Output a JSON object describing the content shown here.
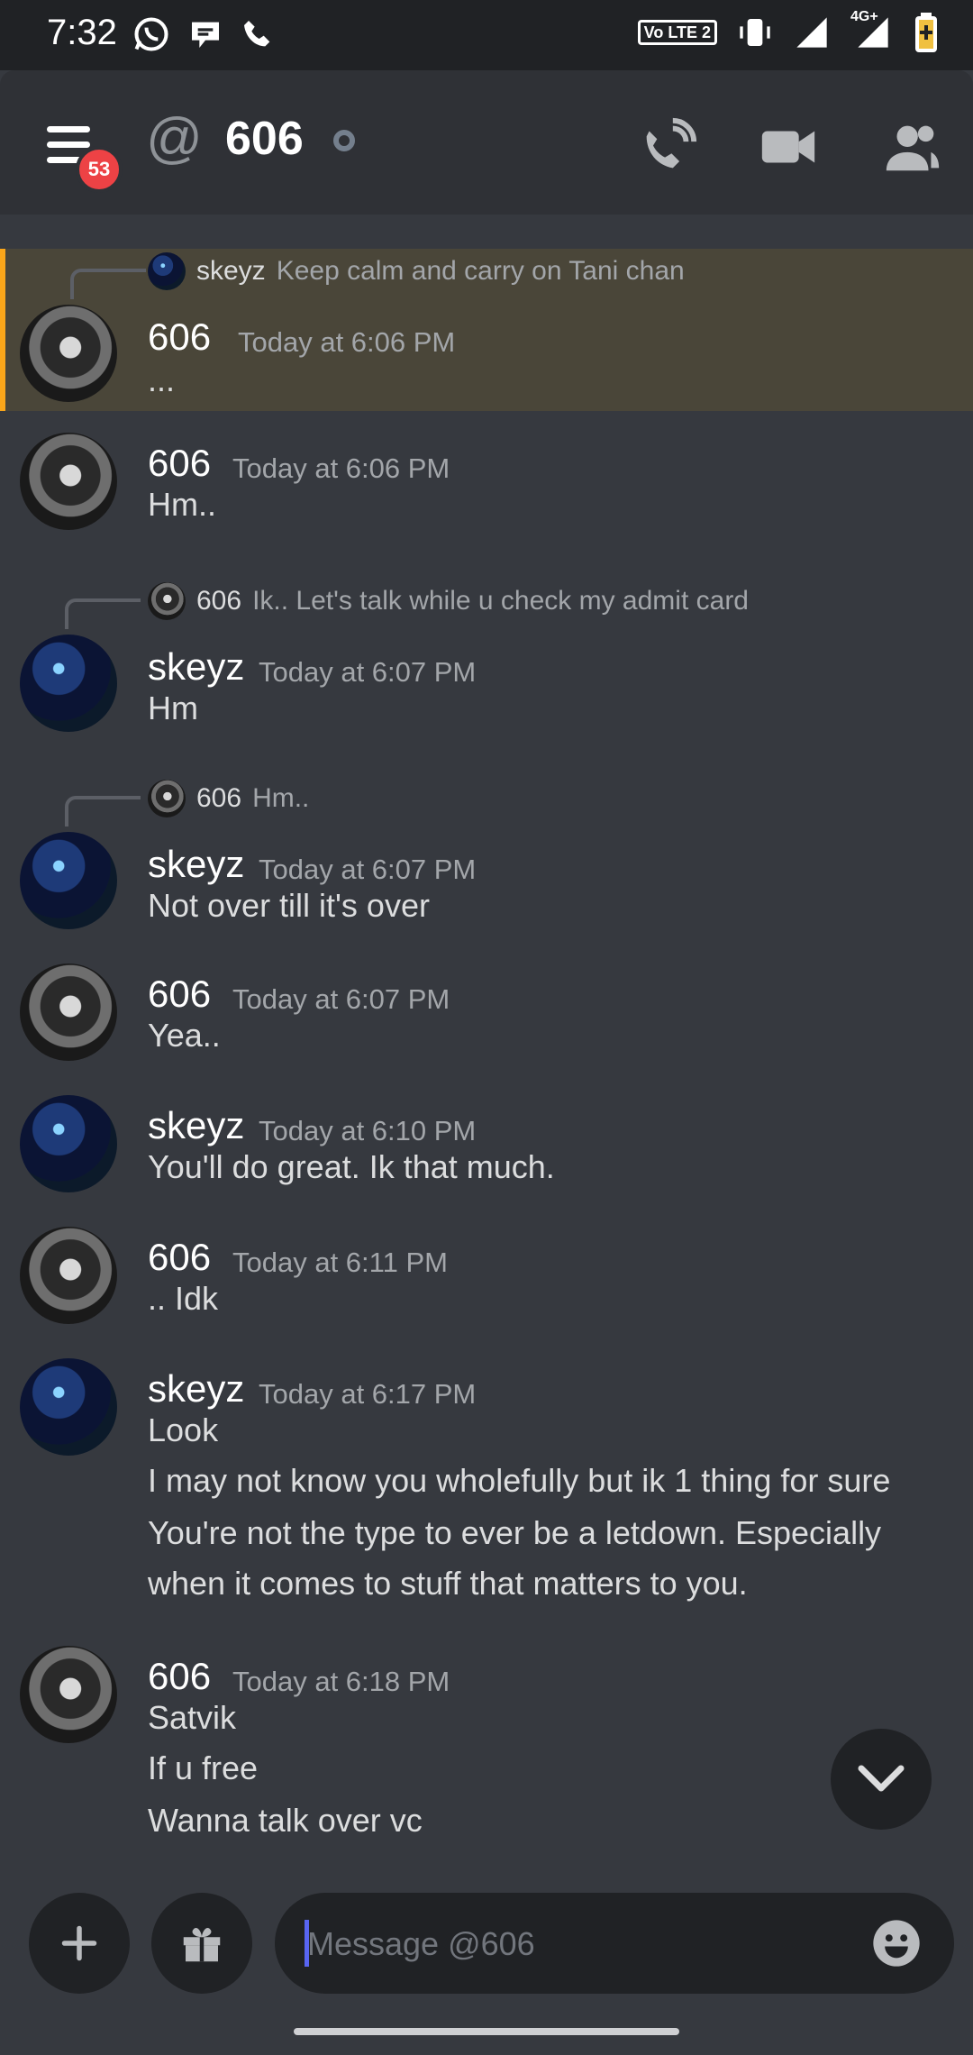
{
  "status_bar": {
    "time": "7:32",
    "network": "4G+",
    "lte": "Vo LTE 2"
  },
  "header": {
    "title": "606",
    "notification_count": "53",
    "icons": [
      "menu-icon",
      "at-icon",
      "voice-call-icon",
      "video-call-icon",
      "members-icon"
    ]
  },
  "messages": [
    {
      "reply": {
        "name": "skeyz",
        "text": "Keep calm and carry on Tani chan"
      },
      "author": "606",
      "time": "Today at 6:06 PM",
      "lines": [
        "..."
      ],
      "highlighted": true
    },
    {
      "author": "606",
      "time": "Today at 6:06 PM",
      "lines": [
        "Hm.."
      ]
    },
    {
      "reply": {
        "name": "606",
        "text": "Ik.. Let's talk while u check my admit card"
      },
      "author": "skeyz",
      "time": "Today at 6:07 PM",
      "lines": [
        "Hm"
      ]
    },
    {
      "reply": {
        "name": "606",
        "text": "Hm.."
      },
      "author": "skeyz",
      "time": "Today at 6:07 PM",
      "lines": [
        "Not over till it's over"
      ]
    },
    {
      "author": "606",
      "time": "Today at 6:07 PM",
      "lines": [
        "Yea.."
      ]
    },
    {
      "author": "skeyz",
      "time": "Today at 6:10 PM",
      "lines": [
        "You'll do great. Ik that much."
      ]
    },
    {
      "author": "606",
      "time": "Today at 6:11 PM",
      "lines": [
        ".. Idk"
      ]
    },
    {
      "author": "skeyz",
      "time": "Today at 6:17 PM",
      "lines": [
        "Look",
        "I may not know you wholefully but ik 1 thing for sure",
        "You're not the type to ever be a letdown. Especially",
        "when it comes to stuff that matters to you."
      ]
    },
    {
      "author": "606",
      "time": "Today at 6:18 PM",
      "lines": [
        "Satvik",
        "If u free",
        "Wanna talk over vc"
      ]
    }
  ],
  "composer": {
    "placeholder": "Message @606"
  },
  "colors": {
    "background": "#36393f",
    "header": "#2f3136",
    "highlight": "#4a4639",
    "highlight_bar": "#faa61a",
    "badge": "#ed4245",
    "accent": "#5865f2"
  }
}
